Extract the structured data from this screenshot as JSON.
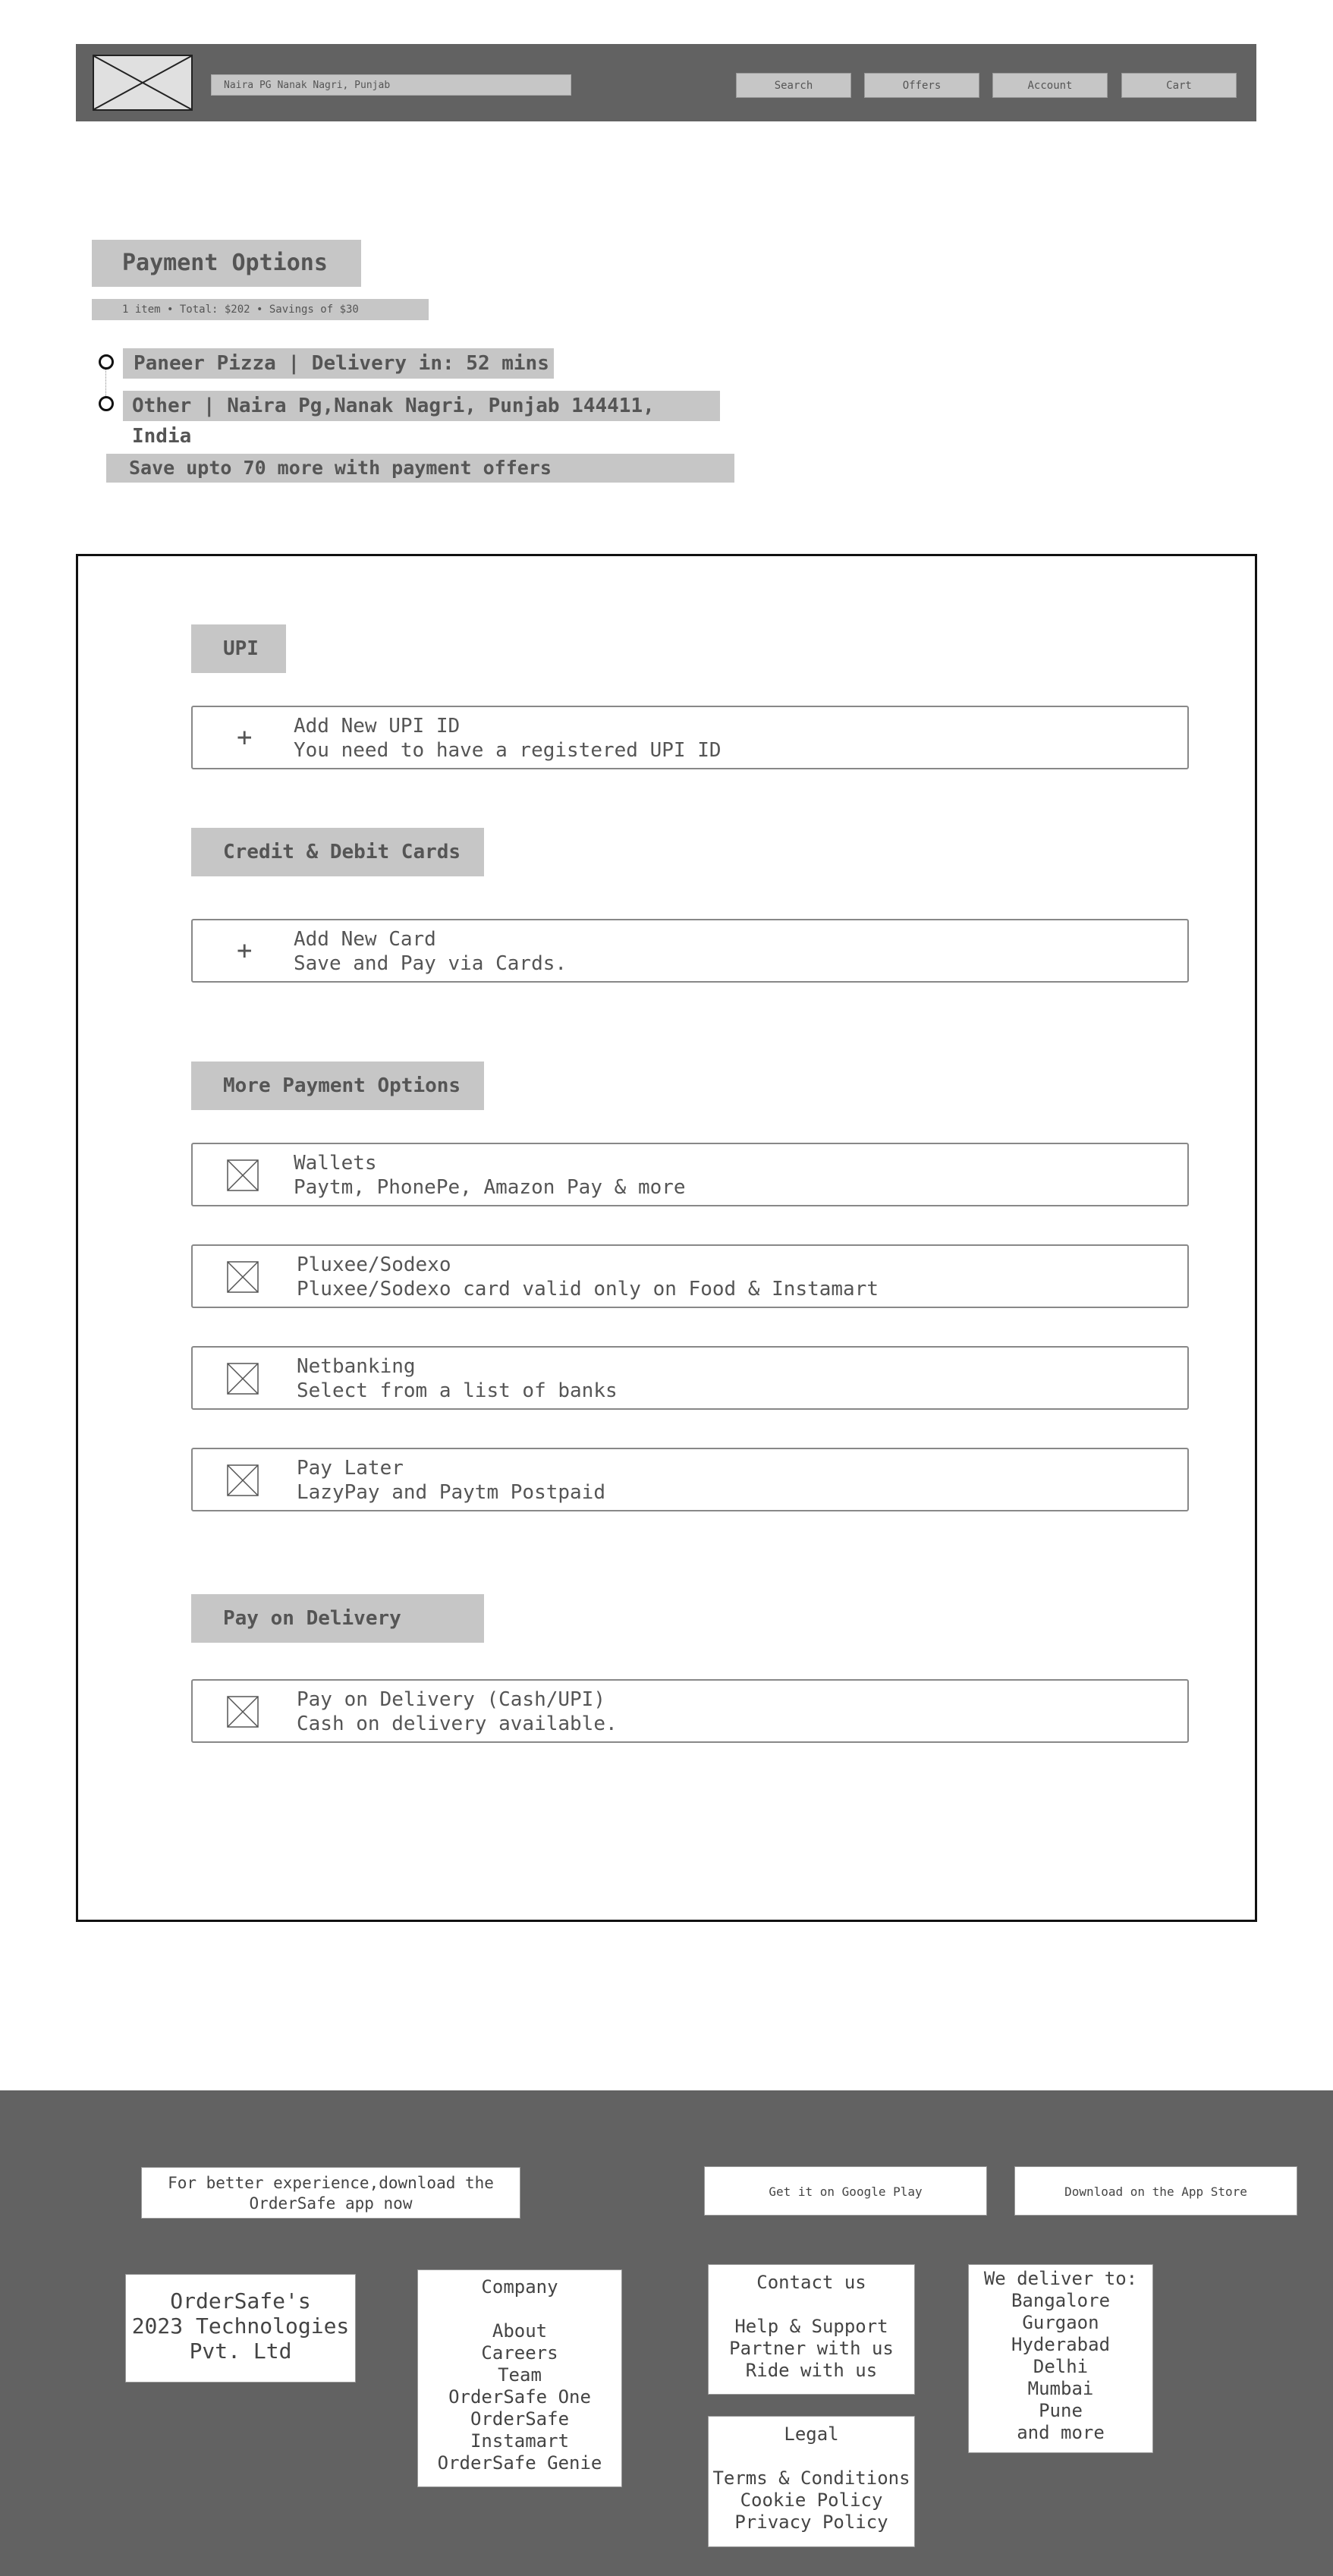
{
  "header": {
    "location": "Naira PG Nanak Nagri, Punjab",
    "nav": [
      "Search",
      "Offers",
      "Account",
      "Cart"
    ]
  },
  "checkout": {
    "title": "Payment Options",
    "summary": "1 item • Total: $202 • Savings of $30",
    "restaurant": "Paneer Pizza | Delivery in: 52 mins",
    "address": "Other | Naira Pg,Nanak Nagri, Punjab 144411, India",
    "offers_banner": "Save upto 70 more with payment offers"
  },
  "payment": {
    "upi": {
      "heading": "UPI",
      "option": {
        "icon": "plus-icon",
        "title": "Add New UPI ID",
        "subtitle": "You need to have a registered UPI ID"
      }
    },
    "cards": {
      "heading": "Credit & Debit Cards",
      "option": {
        "icon": "plus-icon",
        "title": "Add New Card",
        "subtitle": "Save and Pay via Cards."
      }
    },
    "more": {
      "heading": "More Payment Options",
      "options": [
        {
          "icon": "image-placeholder-icon",
          "title": "Wallets",
          "subtitle": "Paytm, PhonePe, Amazon Pay & more"
        },
        {
          "icon": "image-placeholder-icon",
          "title": "Pluxee/Sodexo",
          "subtitle": "Pluxee/Sodexo card valid only on Food & Instamart"
        },
        {
          "icon": "image-placeholder-icon",
          "title": "Netbanking",
          "subtitle": "Select from a list of banks"
        },
        {
          "icon": "image-placeholder-icon",
          "title": "Pay Later",
          "subtitle": "LazyPay and Paytm Postpaid"
        }
      ]
    },
    "cod": {
      "heading": "Pay on Delivery",
      "option": {
        "icon": "image-placeholder-icon",
        "title": "Pay on Delivery (Cash/UPI)",
        "subtitle": "Cash on delivery available."
      }
    }
  },
  "footer": {
    "download_line1": "For better experience,download the",
    "download_line2": "OrderSafe app now",
    "google_play": "Get it on Google Play",
    "app_store": "Download on the App Store",
    "company_name": [
      "OrderSafe's",
      "2023 Technologies",
      "Pvt. Ltd"
    ],
    "company": {
      "title": "Company",
      "links": [
        "About",
        "Careers",
        "Team",
        "OrderSafe One",
        "OrderSafe Instamart",
        "OrderSafe Genie"
      ]
    },
    "contact": {
      "title": "Contact us",
      "links": [
        "Help & Support",
        "Partner with us",
        "Ride with us"
      ]
    },
    "legal": {
      "title": "Legal",
      "links": [
        "Terms & Conditions",
        "Cookie Policy",
        "Privacy Policy"
      ]
    },
    "deliver": {
      "title": "We deliver to:",
      "cities": [
        "Bangalore",
        "Gurgaon",
        "Hyderabad",
        "Delhi",
        "Mumbai",
        "Pune",
        "and more"
      ]
    }
  },
  "colors": {
    "header_bg": "#626262",
    "placeholder_gray": "#c6c6c6",
    "footer_bg": "#626262",
    "text": "#555555"
  }
}
